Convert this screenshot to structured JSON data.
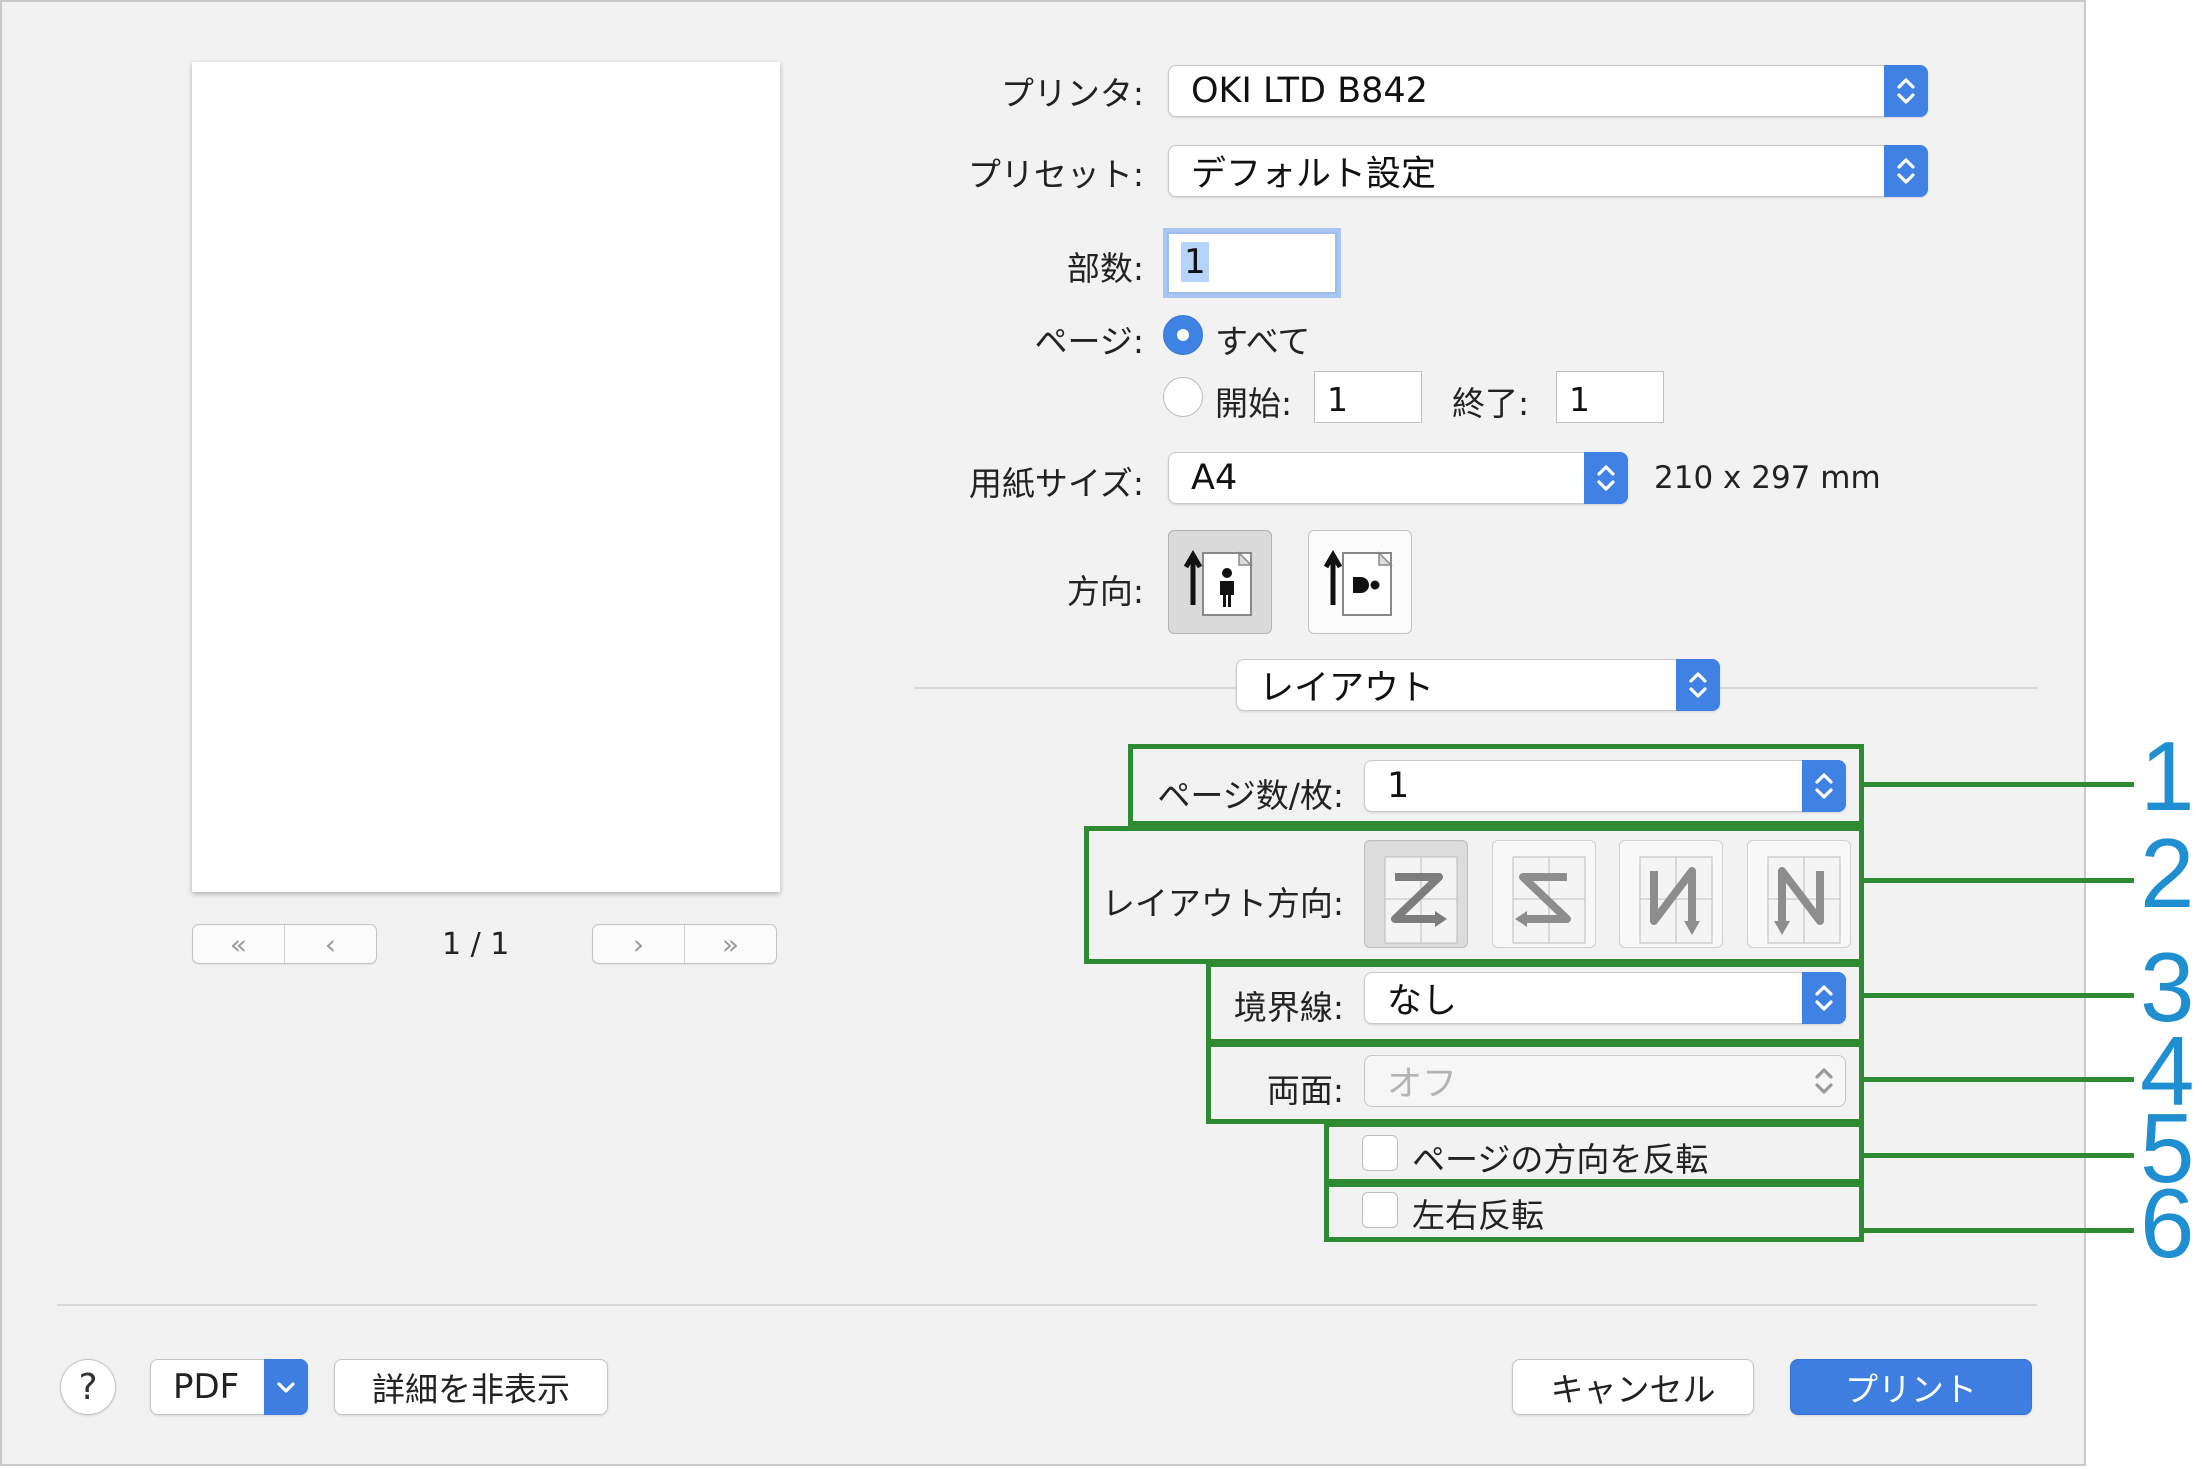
{
  "printer": {
    "label": "プリンタ:",
    "value": "OKI LTD B842"
  },
  "preset": {
    "label": "プリセット:",
    "value": "デフォルト設定"
  },
  "copies": {
    "label": "部数:",
    "value": "1"
  },
  "pages": {
    "label": "ページ:",
    "all_label": "すべて",
    "all_selected": true,
    "from_label": "開始:",
    "from_value": "1",
    "to_label": "終了:",
    "to_value": "1"
  },
  "paper_size": {
    "label": "用紙サイズ:",
    "value": "A4",
    "dimensions": "210 x 297 mm"
  },
  "orientation": {
    "label": "方向:",
    "options": [
      "portrait-icon",
      "landscape-icon"
    ],
    "selected": "portrait"
  },
  "section_popup": {
    "value": "レイアウト"
  },
  "layout": {
    "pages_per_sheet": {
      "label": "ページ数/枚:",
      "value": "1"
    },
    "layout_direction": {
      "label": "レイアウト方向:",
      "options": [
        "z-order-icon",
        "reverse-z-order-icon",
        "reverse-n-order-icon",
        "n-order-icon"
      ],
      "selected_index": 0
    },
    "border": {
      "label": "境界線:",
      "value": "なし"
    },
    "two_sided": {
      "label": "両面:",
      "value": "オフ",
      "enabled": false
    },
    "reverse_orientation": {
      "label": "ページの方向を反転",
      "checked": false
    },
    "flip_horizontally": {
      "label": "左右反転",
      "checked": false
    }
  },
  "preview": {
    "page_counter": "1 / 1",
    "nav_icons": [
      "first-page-icon",
      "prev-page-icon",
      "next-page-icon",
      "last-page-icon"
    ]
  },
  "callouts": [
    "1",
    "2",
    "3",
    "4",
    "5",
    "6"
  ],
  "footer": {
    "help_label": "?",
    "pdf_label": "PDF",
    "hide_details_label": "詳細を非表示",
    "cancel_label": "キャンセル",
    "print_label": "プリント"
  },
  "colors": {
    "accent": "#3e7ee0",
    "callout_box": "#2e8b33",
    "callout_number": "#1f8fd1"
  }
}
